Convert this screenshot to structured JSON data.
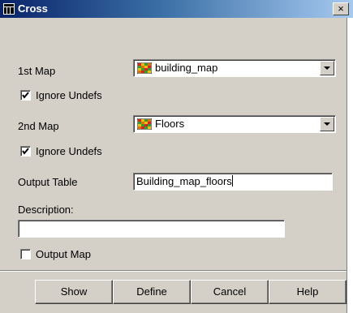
{
  "window": {
    "title": "Cross",
    "close_glyph": "×"
  },
  "form": {
    "map1": {
      "label": "1st Map",
      "value": "building_map",
      "icon": "raster-map-icon"
    },
    "ignore1": {
      "label": "Ignore Undefs",
      "checked": true
    },
    "map2": {
      "label": "2nd Map",
      "value": "Floors",
      "icon": "raster-map-icon"
    },
    "ignore2": {
      "label": "Ignore Undefs",
      "checked": true
    },
    "output_table": {
      "label": "Output Table",
      "value": "Building_map_floors"
    },
    "description": {
      "label": "Description:",
      "value": ""
    },
    "output_map": {
      "label": "Output Map",
      "checked": false
    }
  },
  "buttons": {
    "show": "Show",
    "define": "Define",
    "cancel": "Cancel",
    "help": "Help"
  },
  "colors": {
    "title_start": "#0a246a",
    "title_end": "#a6caf0",
    "face": "#d4d0c8"
  }
}
